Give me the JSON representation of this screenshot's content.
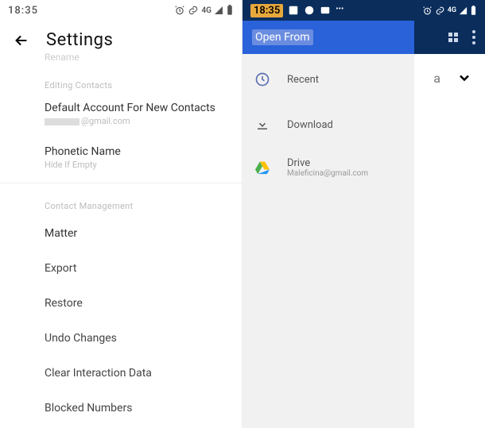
{
  "left": {
    "status": {
      "time": "18:35",
      "net": "4G"
    },
    "header": {
      "title": "Settings",
      "subtitle": "Rename"
    },
    "editing_contacts": {
      "header": "Editing Contacts",
      "default_account": {
        "title": "Default Account For New Contacts",
        "sub_suffix": "@gmail.com"
      },
      "phonetic_name": {
        "title": "Phonetic Name",
        "sub": "Hide If Empty"
      }
    },
    "management": {
      "header": "Contact Management",
      "items": [
        "Matter",
        "Export",
        "Restore",
        "Undo Changes",
        "Clear Interaction Data",
        "Blocked Numbers"
      ]
    }
  },
  "right": {
    "status": {
      "time": "18:35",
      "net": "4G"
    },
    "appbar": {
      "title": "Open From"
    },
    "items": {
      "recent": {
        "label": "Recent"
      },
      "download": {
        "label": "Download"
      },
      "drive": {
        "label": "Drive",
        "sub": "Maleficina@gmail.com"
      }
    },
    "side": {
      "letter": "a"
    }
  }
}
